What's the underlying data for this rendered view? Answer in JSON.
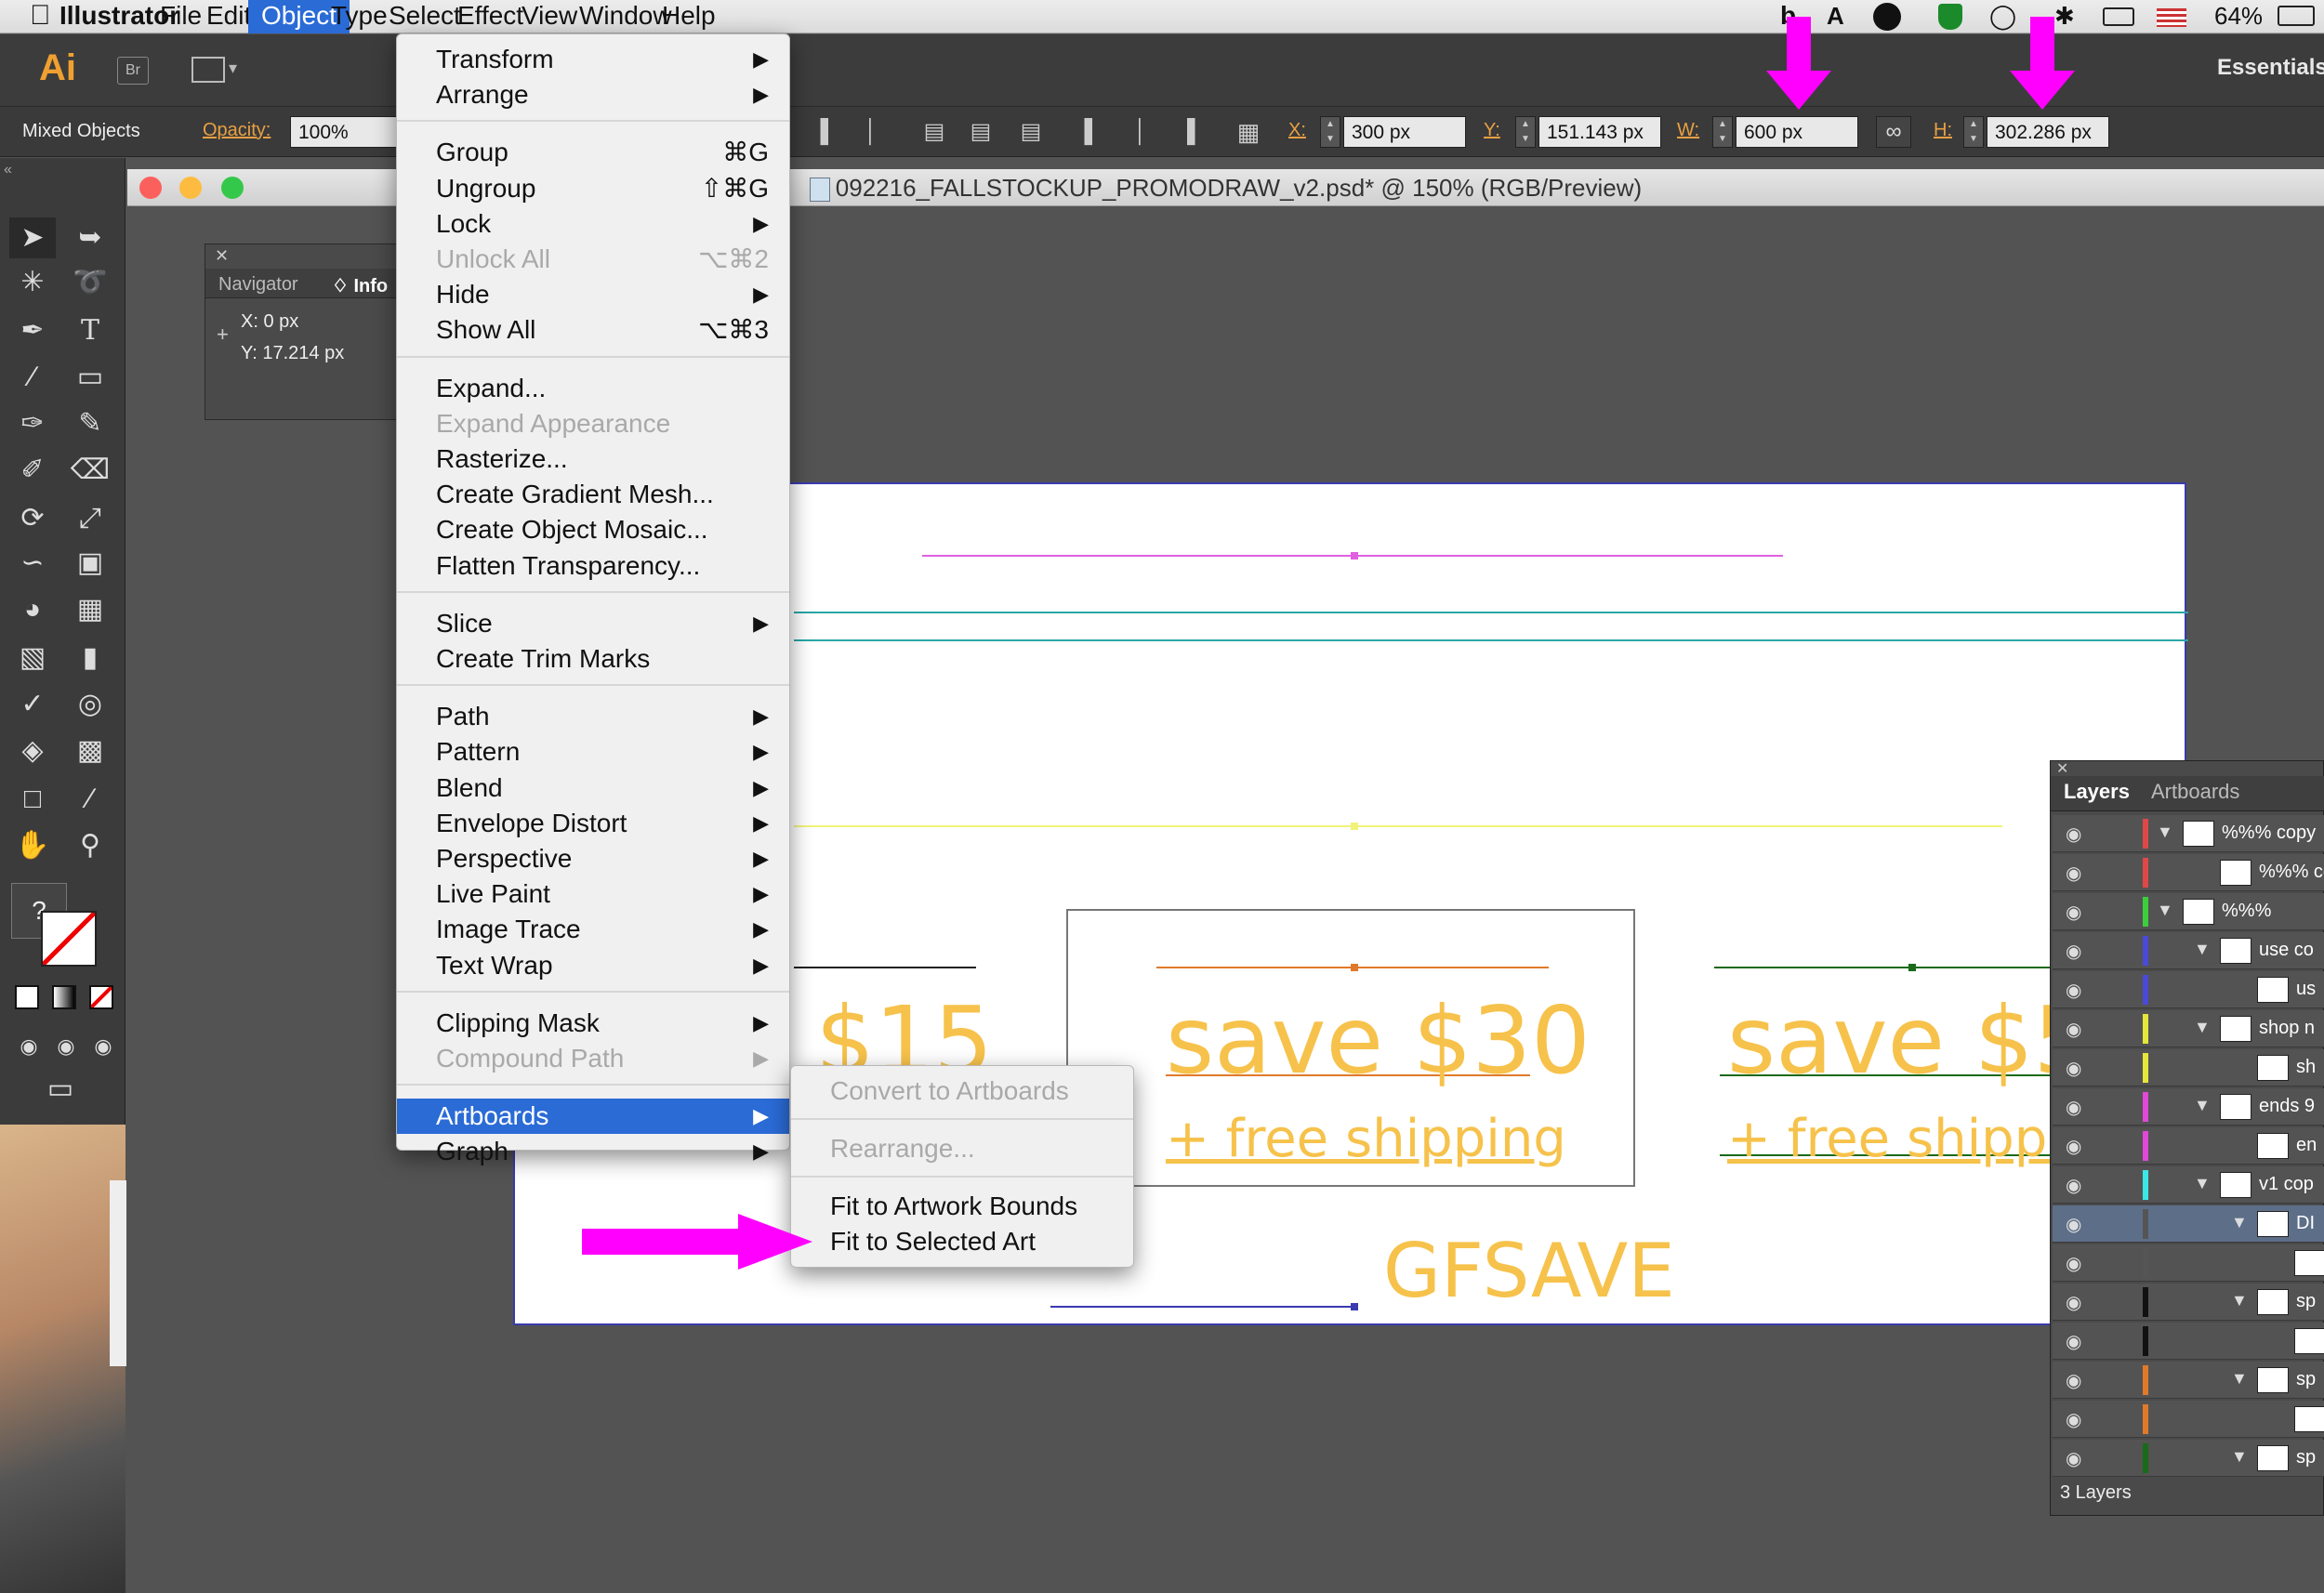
{
  "menubar": {
    "apple": "",
    "app_name": "Illustrator",
    "items": [
      "File",
      "Edit",
      "Object",
      "Type",
      "Select",
      "Effect",
      "View",
      "Window",
      "Help"
    ],
    "active": "Object",
    "battery": "64%"
  },
  "appbar": {
    "ai_logo": "Ai",
    "bridge": "Br",
    "workspace": "Essentials"
  },
  "control_bar": {
    "selection": "Mixed Objects",
    "opacity_label": "Opacity:",
    "opacity_value": "100%",
    "x_label": "X:",
    "x_value": "300 px",
    "y_label": "Y:",
    "y_value": "151.143 px",
    "w_label": "W:",
    "w_value": "600 px",
    "h_label": "H:",
    "h_value": "302.286 px"
  },
  "document": {
    "title": "092216_FALLSTOCKUP_PROMODRAW_v2.psd* @ 150% (RGB/Preview)"
  },
  "navigator": {
    "tab1": "Navigator",
    "tab2": "♢ Info",
    "x": "X:  0 px",
    "y": "Y:  17.214 px"
  },
  "object_menu": {
    "items": [
      {
        "label": "Transform",
        "shortcut": "",
        "sub": true,
        "disabled": false
      },
      {
        "label": "Arrange",
        "shortcut": "",
        "sub": true,
        "disabled": false
      },
      {
        "label": "Group",
        "shortcut": "⌘G",
        "sub": false,
        "disabled": false
      },
      {
        "label": "Ungroup",
        "shortcut": "⇧⌘G",
        "sub": false,
        "disabled": false
      },
      {
        "label": "Lock",
        "shortcut": "",
        "sub": true,
        "disabled": false
      },
      {
        "label": "Unlock All",
        "shortcut": "⌥⌘2",
        "sub": false,
        "disabled": true
      },
      {
        "label": "Hide",
        "shortcut": "",
        "sub": true,
        "disabled": false
      },
      {
        "label": "Show All",
        "shortcut": "⌥⌘3",
        "sub": false,
        "disabled": false
      },
      {
        "label": "Expand...",
        "shortcut": "",
        "sub": false,
        "disabled": false
      },
      {
        "label": "Expand Appearance",
        "shortcut": "",
        "sub": false,
        "disabled": true
      },
      {
        "label": "Rasterize...",
        "shortcut": "",
        "sub": false,
        "disabled": false
      },
      {
        "label": "Create Gradient Mesh...",
        "shortcut": "",
        "sub": false,
        "disabled": false
      },
      {
        "label": "Create Object Mosaic...",
        "shortcut": "",
        "sub": false,
        "disabled": false
      },
      {
        "label": "Flatten Transparency...",
        "shortcut": "",
        "sub": false,
        "disabled": false
      },
      {
        "label": "Slice",
        "shortcut": "",
        "sub": true,
        "disabled": false
      },
      {
        "label": "Create Trim Marks",
        "shortcut": "",
        "sub": false,
        "disabled": false
      },
      {
        "label": "Path",
        "shortcut": "",
        "sub": true,
        "disabled": false
      },
      {
        "label": "Pattern",
        "shortcut": "",
        "sub": true,
        "disabled": false
      },
      {
        "label": "Blend",
        "shortcut": "",
        "sub": true,
        "disabled": false
      },
      {
        "label": "Envelope Distort",
        "shortcut": "",
        "sub": true,
        "disabled": false
      },
      {
        "label": "Perspective",
        "shortcut": "",
        "sub": true,
        "disabled": false
      },
      {
        "label": "Live Paint",
        "shortcut": "",
        "sub": true,
        "disabled": false
      },
      {
        "label": "Image Trace",
        "shortcut": "",
        "sub": true,
        "disabled": false
      },
      {
        "label": "Text Wrap",
        "shortcut": "",
        "sub": true,
        "disabled": false
      },
      {
        "label": "Clipping Mask",
        "shortcut": "",
        "sub": true,
        "disabled": false
      },
      {
        "label": "Compound Path",
        "shortcut": "",
        "sub": true,
        "disabled": true
      },
      {
        "label": "Artboards",
        "shortcut": "",
        "sub": true,
        "disabled": false,
        "highlighted": true
      },
      {
        "label": "Graph",
        "shortcut": "",
        "sub": true,
        "disabled": false
      }
    ]
  },
  "artboards_submenu": {
    "items": [
      {
        "label": "Convert to Artboards",
        "disabled": true
      },
      {
        "label": "Rearrange...",
        "disabled": true
      },
      {
        "label": "Fit to Artwork Bounds",
        "disabled": false
      },
      {
        "label": "Fit to Selected Art",
        "disabled": false
      }
    ]
  },
  "artwork": {
    "save15": "e $15",
    "save30": "save $30",
    "save50": "save $5",
    "ship30": "+ free shipping",
    "ship50": "+ free shippin",
    "code": "GFSAVE"
  },
  "layers_panel": {
    "tab_layers": "Layers",
    "tab_artboards": "Artboards",
    "footer": "3 Layers",
    "rows": [
      {
        "name": "%%% copy",
        "color": "#e04848"
      },
      {
        "name": "%%% co",
        "color": "#e04848"
      },
      {
        "name": "%%%",
        "color": "#3ccf3c"
      },
      {
        "name": "use co",
        "color": "#4a4ad8"
      },
      {
        "name": "us",
        "color": "#4a4ad8"
      },
      {
        "name": "shop n",
        "color": "#e6e63c"
      },
      {
        "name": "sh",
        "color": "#e6e63c"
      },
      {
        "name": "ends 9",
        "color": "#e048d8"
      },
      {
        "name": "en",
        "color": "#e048d8"
      },
      {
        "name": "v1 cop",
        "color": "#3ce6e6"
      },
      {
        "name": "DI",
        "color": "#555555"
      },
      {
        "name": "",
        "color": "#555555"
      },
      {
        "name": "sp",
        "color": "#111111"
      },
      {
        "name": "",
        "color": "#111111"
      },
      {
        "name": "sp",
        "color": "#e07a2a"
      },
      {
        "name": "",
        "color": "#e07a2a"
      },
      {
        "name": "sp",
        "color": "#1a6a1a"
      }
    ]
  },
  "colors": {
    "accent_blue": "#2a6bd6",
    "annotation_magenta": "#ff00ff",
    "art_orange": "#f6c24b"
  }
}
